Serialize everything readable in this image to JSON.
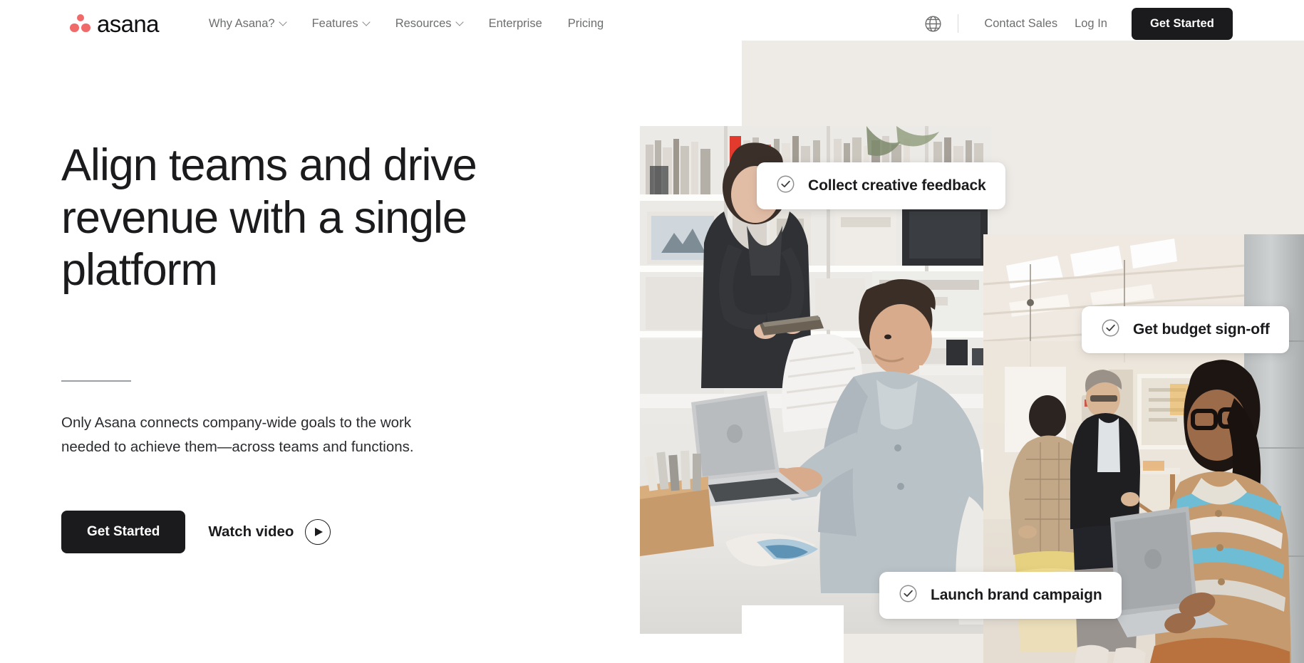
{
  "brand": {
    "name": "asana",
    "logo_icon": "asana-dots-logo",
    "dot_color": "#f06a6a",
    "wordmark_color": "#0d0e10"
  },
  "header": {
    "nav": [
      {
        "label": "Why Asana?",
        "has_chevron": true,
        "icon": "chevron-down-icon"
      },
      {
        "label": "Features",
        "has_chevron": true,
        "icon": "chevron-down-icon"
      },
      {
        "label": "Resources",
        "has_chevron": true,
        "icon": "chevron-down-icon"
      },
      {
        "label": "Enterprise",
        "has_chevron": false,
        "icon": ""
      },
      {
        "label": "Pricing",
        "has_chevron": false,
        "icon": ""
      }
    ],
    "language_icon": "globe-icon",
    "contact_sales_label": "Contact Sales",
    "login_label": "Log In",
    "get_started_label": "Get Started",
    "get_started_bg": "#1b1b1d",
    "get_started_text_color": "#ffffff"
  },
  "hero": {
    "title": "Align teams and drive revenue with a single platform",
    "subtitle": "Only Asana connects company-wide goals to the work needed to achieve them—across teams and functions.",
    "primary_cta_label": "Get Started",
    "secondary_cta_label": "Watch video",
    "secondary_cta_icon": "play-circle-icon",
    "title_color": "#1b1b1d",
    "panel_bg": "#eeebe7"
  },
  "art": {
    "photos": [
      {
        "name": "studio-desk-photo",
        "alt": "Two colleagues working together at a white studio desk with a laptop"
      },
      {
        "name": "warehouse-laptop-photo",
        "alt": "Woman in striped shirt holding a laptop in an open workspace"
      }
    ],
    "chips": [
      {
        "label": "Collect creative feedback",
        "icon": "check-circle-icon"
      },
      {
        "label": "Get budget sign-off",
        "icon": "check-circle-icon"
      },
      {
        "label": "Launch brand campaign",
        "icon": "check-circle-icon"
      }
    ],
    "chip_bg": "#ffffff",
    "chip_text_color": "#1b1b1d"
  }
}
